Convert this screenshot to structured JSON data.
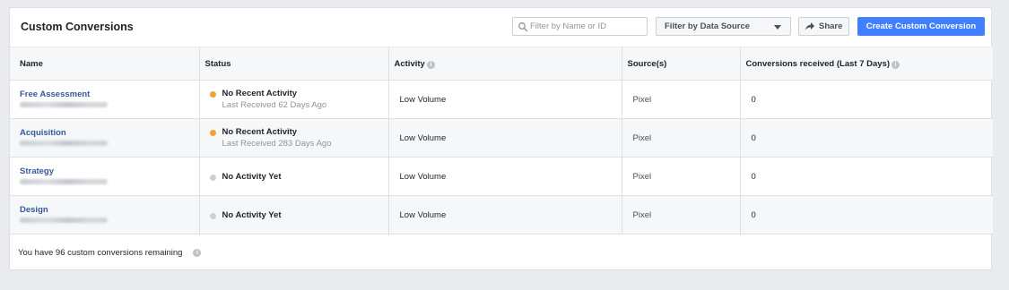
{
  "page": {
    "title": "Custom Conversions"
  },
  "toolbar": {
    "search_placeholder": "Filter by Name or ID",
    "search_value": "",
    "filter_label": "Filter by Data Source",
    "share_label": "Share",
    "create_label": "Create Custom Conversion",
    "accent_color": "#4080ff"
  },
  "table": {
    "columns": [
      {
        "label": "Name",
        "info": false
      },
      {
        "label": "Status",
        "info": false
      },
      {
        "label": "Activity",
        "info": true
      },
      {
        "label": "Source(s)",
        "info": false
      },
      {
        "label": "Conversions received (Last 7 Days)",
        "info": true
      }
    ],
    "rows": [
      {
        "name": "Free Assessment",
        "status_title": "No Recent Activity",
        "status_sub": "Last Received 62 Days Ago",
        "status_color": "#f0a232",
        "activity": "Low Volume",
        "source": "Pixel",
        "conversions": "0"
      },
      {
        "name": "Acquisition",
        "status_title": "No Recent Activity",
        "status_sub": "Last Received 283 Days Ago",
        "status_color": "#f0a232",
        "activity": "Low Volume",
        "source": "Pixel",
        "conversions": "0"
      },
      {
        "name": "Strategy",
        "status_title": "No Activity Yet",
        "status_sub": "",
        "status_color": "#cdd0d4",
        "activity": "Low Volume",
        "source": "Pixel",
        "conversions": "0"
      },
      {
        "name": "Design",
        "status_title": "No Activity Yet",
        "status_sub": "",
        "status_color": "#cdd0d4",
        "activity": "Low Volume",
        "source": "Pixel",
        "conversions": "0"
      }
    ]
  },
  "footer": {
    "remaining_text": "You have 96 custom conversions remaining"
  },
  "icons": {
    "search": "search-icon",
    "dropdown": "caret-down-icon",
    "share": "share-arrow-icon",
    "info": "info-icon"
  }
}
